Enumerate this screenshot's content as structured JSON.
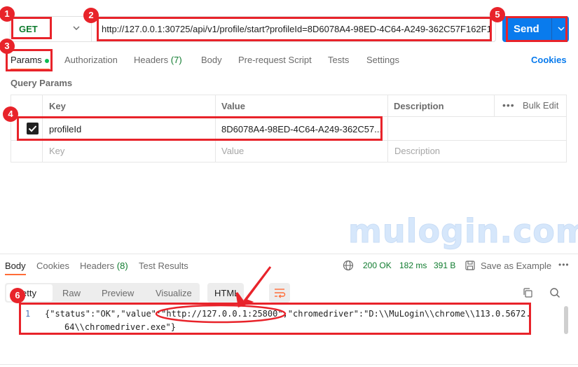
{
  "request": {
    "method": "GET",
    "url": "http://127.0.0.1:30725/api/v1/profile/start?profileId=8D6078A4-98ED-4C64-A249-362C57F162F1",
    "send_label": "Send"
  },
  "request_tabs": {
    "params": "Params",
    "authorization": "Authorization",
    "headers": "Headers",
    "headers_count": "(7)",
    "body": "Body",
    "pre_request": "Pre-request Script",
    "tests": "Tests",
    "settings": "Settings",
    "cookies": "Cookies"
  },
  "query_params": {
    "title": "Query Params",
    "columns": {
      "key": "Key",
      "value": "Value",
      "description": "Description"
    },
    "bulk_edit": "Bulk Edit",
    "rows": [
      {
        "key": "profileId",
        "value": "8D6078A4-98ED-4C64-A249-362C57...",
        "description": ""
      }
    ],
    "placeholders": {
      "key": "Key",
      "value": "Value",
      "description": "Description"
    }
  },
  "watermark": "mulogin.com",
  "response": {
    "tabs": {
      "body": "Body",
      "cookies": "Cookies",
      "headers": "Headers",
      "headers_count": "(8)",
      "test_results": "Test Results"
    },
    "status": "200 OK",
    "time": "182 ms",
    "size": "391 B",
    "save_as_example": "Save as Example",
    "formats": {
      "pretty": "Pretty",
      "raw": "Raw",
      "preview": "Preview",
      "visualize": "Visualize",
      "type": "HTML"
    },
    "line_number": "1",
    "code_line1_a": "{\"status\":\"OK\",\"value\":",
    "code_url": "\"http://127.0.0.1:25800\"",
    "code_line1_b": ",\"chromedriver\":\"D:\\\\MuLogin\\\\chrome\\\\113.0.5672.",
    "code_line2": "64\\\\chromedriver.exe\"}"
  },
  "annotations": {
    "badge1": "1",
    "badge2": "2",
    "badge3": "3",
    "badge4": "4",
    "badge5": "5",
    "badge6": "6"
  },
  "colors": {
    "accent": "#097bed",
    "annotation": "#e8232a",
    "get_method": "#0f7b2e",
    "tab_underline": "#ff6c37"
  }
}
